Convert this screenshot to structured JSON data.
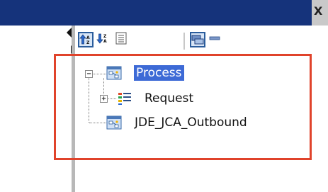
{
  "window": {
    "close_glyph": "X"
  },
  "toolbar": {
    "buttons": [
      {
        "name": "sort-ascending-button",
        "icon": "sort-ascending-icon",
        "selected": true
      },
      {
        "name": "sort-descending-button",
        "icon": "sort-descending-icon",
        "selected": false
      },
      {
        "name": "list-view-button",
        "icon": "list-icon",
        "selected": false
      },
      {
        "name": "show-hierarchy-button",
        "icon": "hierarchy-icon",
        "selected": true
      },
      {
        "name": "collapse-button",
        "icon": "minus-icon",
        "selected": false
      }
    ]
  },
  "tree": {
    "nodes": [
      {
        "label": "Process",
        "icon": "process-icon",
        "selected": true,
        "expanded": true
      },
      {
        "label": "Request",
        "icon": "message-parts-icon",
        "selected": false,
        "expanded": false
      },
      {
        "label": "JDE_JCA_Outbound",
        "icon": "process-icon",
        "selected": false
      }
    ]
  },
  "annotation": {
    "color": "#e0432b"
  },
  "colors": {
    "titlebar": "#15337b",
    "selection": "#3d6ad6"
  }
}
